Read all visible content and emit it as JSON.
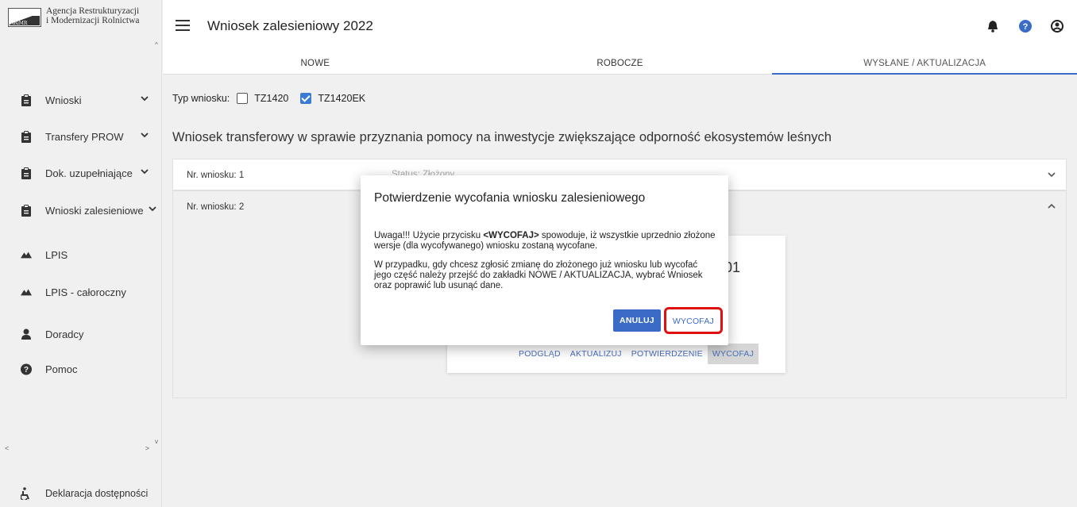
{
  "logo": {
    "line1": "Agencja Restrukturyzacji",
    "line2": "i Modernizacji Rolnictwa"
  },
  "sidebar": {
    "items": [
      {
        "label": "Wnioski",
        "icon": "clipboard-icon",
        "has_chevron": true
      },
      {
        "label": "Transfery PROW",
        "icon": "clipboard-icon",
        "has_chevron": true
      },
      {
        "label": "Dok. uzupełniające",
        "icon": "clipboard-icon",
        "has_chevron": true
      },
      {
        "label": "Wnioski zalesieniowe",
        "icon": "clipboard-icon",
        "has_chevron": true
      },
      {
        "label": "LPIS",
        "icon": "mountain-icon",
        "has_chevron": false
      },
      {
        "label": "LPIS - całoroczny",
        "icon": "mountain-icon",
        "has_chevron": false
      },
      {
        "label": "Doradcy",
        "icon": "user-icon",
        "has_chevron": false
      },
      {
        "label": "Pomoc",
        "icon": "question-circle-icon",
        "has_chevron": false
      }
    ],
    "footer_label": "Deklaracja dostępności"
  },
  "header": {
    "title": "Wniosek zalesieniowy 2022",
    "tabs": [
      {
        "label": "NOWE"
      },
      {
        "label": "ROBOCZE"
      },
      {
        "label": "WYSŁANE / AKTUALIZACJA"
      }
    ],
    "active_tab": "WYSŁANE / AKTUALIZACJA"
  },
  "filter": {
    "label": "Typ wniosku:",
    "options": [
      {
        "label": "TZ1420",
        "checked": false
      },
      {
        "label": "TZ1420EK",
        "checked": true
      }
    ]
  },
  "main": {
    "section_title": "Wniosek transferowy w sprawie przyznania pomocy na inwestycje zwiększające odporność ekosystemów leśnych",
    "panels": [
      {
        "label": "Nr. wniosku: 1",
        "status": "Status: Złożony"
      },
      {
        "label": "Nr. wniosku: 2"
      }
    ],
    "card": {
      "number_fragment": "01",
      "actions": [
        "PODGLĄD",
        "AKTUALIZUJ",
        "POTWIERDZENIE",
        "WYCOFAJ"
      ]
    }
  },
  "dialog": {
    "title": "Potwierdzenie wycofania wniosku zalesieniowego",
    "para1_prefix": "Uwaga!!! Użycie przycisku ",
    "para1_bold": "<WYCOFAJ>",
    "para1_suffix": " spowoduje, iż wszystkie uprzednio złożone wersje (dla wycofywanego) wniosku zostaną wycofane.",
    "para2": "W przypadku, gdy chcesz zgłosić zmianę do złożonego już wniosku lub wycofać jego część należy przejść do zakładki NOWE / AKTUALIZACJA, wybrać Wniosek oraz poprawić lub usunąć dane.",
    "cancel_label": "ANULUJ",
    "confirm_label": "WYCOFAJ"
  },
  "colors": {
    "accent": "#3a6bc7",
    "highlight_border": "#e01010",
    "checkbox": "#3a7bd5"
  }
}
